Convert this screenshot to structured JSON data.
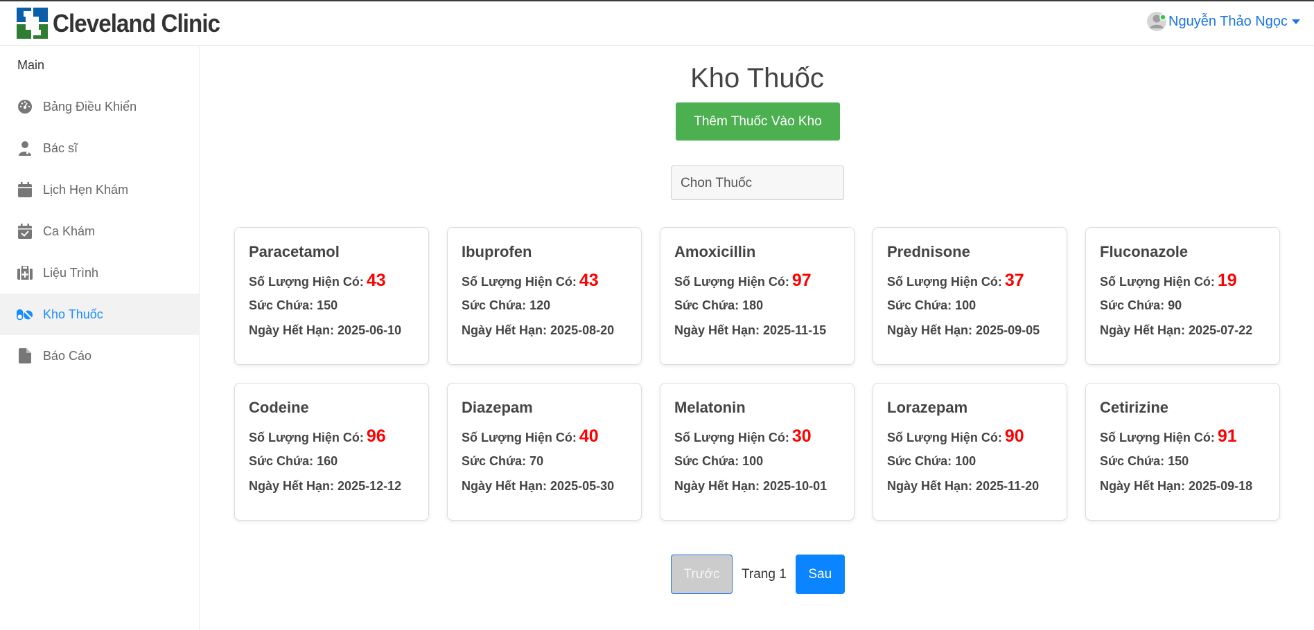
{
  "header": {
    "brand": "Cleveland Clinic",
    "user_name": "Nguyễn Thảo Ngọc"
  },
  "sidebar": {
    "section": "Main",
    "items": [
      {
        "label": "Bảng Điều Khiển",
        "icon": "dashboard-icon"
      },
      {
        "label": "Bác sĩ",
        "icon": "doctor-icon"
      },
      {
        "label": "Lịch Hẹn Khám",
        "icon": "calendar-icon"
      },
      {
        "label": "Ca Khám",
        "icon": "calendar-check-icon"
      },
      {
        "label": "Liệu Trình",
        "icon": "medical-kit-icon"
      },
      {
        "label": "Kho Thuốc",
        "icon": "pills-icon",
        "active": true
      },
      {
        "label": "Báo Cáo",
        "icon": "file-icon"
      }
    ]
  },
  "main": {
    "title": "Kho Thuốc",
    "add_button": "Thêm Thuốc Vào Kho",
    "select_placeholder": "Chon Thuốc",
    "labels": {
      "quantity": "Số Lượng Hiện Có:",
      "capacity": "Sức Chứa:",
      "expiry": "Ngày Hết Hạn:"
    },
    "medicines": [
      {
        "name": "Paracetamol",
        "quantity": "43",
        "capacity": "150",
        "expiry": "2025-06-10"
      },
      {
        "name": "Ibuprofen",
        "quantity": "43",
        "capacity": "120",
        "expiry": "2025-08-20"
      },
      {
        "name": "Amoxicillin",
        "quantity": "97",
        "capacity": "180",
        "expiry": "2025-11-15"
      },
      {
        "name": "Prednisone",
        "quantity": "37",
        "capacity": "100",
        "expiry": "2025-09-05"
      },
      {
        "name": "Fluconazole",
        "quantity": "19",
        "capacity": "90",
        "expiry": "2025-07-22"
      },
      {
        "name": "Codeine",
        "quantity": "96",
        "capacity": "160",
        "expiry": "2025-12-12"
      },
      {
        "name": "Diazepam",
        "quantity": "40",
        "capacity": "70",
        "expiry": "2025-05-30"
      },
      {
        "name": "Melatonin",
        "quantity": "30",
        "capacity": "100",
        "expiry": "2025-10-01"
      },
      {
        "name": "Lorazepam",
        "quantity": "90",
        "capacity": "100",
        "expiry": "2025-11-20"
      },
      {
        "name": "Cetirizine",
        "quantity": "91",
        "capacity": "150",
        "expiry": "2025-09-18"
      }
    ],
    "pagination": {
      "prev": "Trước",
      "page_label": "Trang 1",
      "next": "Sau"
    }
  },
  "colors": {
    "accent": "#1a73e8",
    "add_button": "#4caf50",
    "quantity": "#ff0000",
    "next_button": "#0a84ff",
    "logo_blue": "#0b5ea8",
    "logo_green": "#2e7d32"
  }
}
